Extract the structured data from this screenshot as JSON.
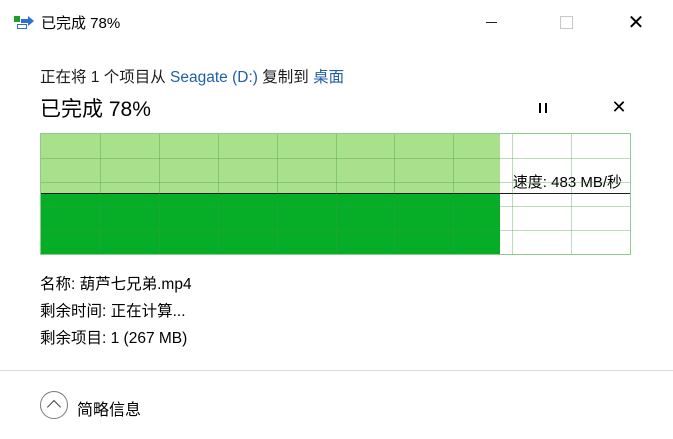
{
  "window": {
    "title": "已完成 78%"
  },
  "copy": {
    "prefix": "正在将 1 个项目从 ",
    "source": "Seagate (D:)",
    "middle": " 复制到 ",
    "destination": "桌面"
  },
  "progress": {
    "title": "已完成 78%",
    "percent": 78,
    "speed_label": "速度: 483 MB/秒"
  },
  "details": {
    "name": "名称:  葫芦七兄弟.mp4",
    "time_remaining": "剩余时间:  正在计算...",
    "items_remaining": "剩余项目:  1 (267 MB)"
  },
  "footer": {
    "label": "简略信息"
  },
  "colors": {
    "graph_fill_light": "#a8e08c",
    "graph_fill_dark": "#06ae27",
    "link": "#1f5fa8"
  },
  "icons": [
    "copy-icon",
    "pause-icon",
    "close-icon",
    "chevron-up-icon"
  ]
}
